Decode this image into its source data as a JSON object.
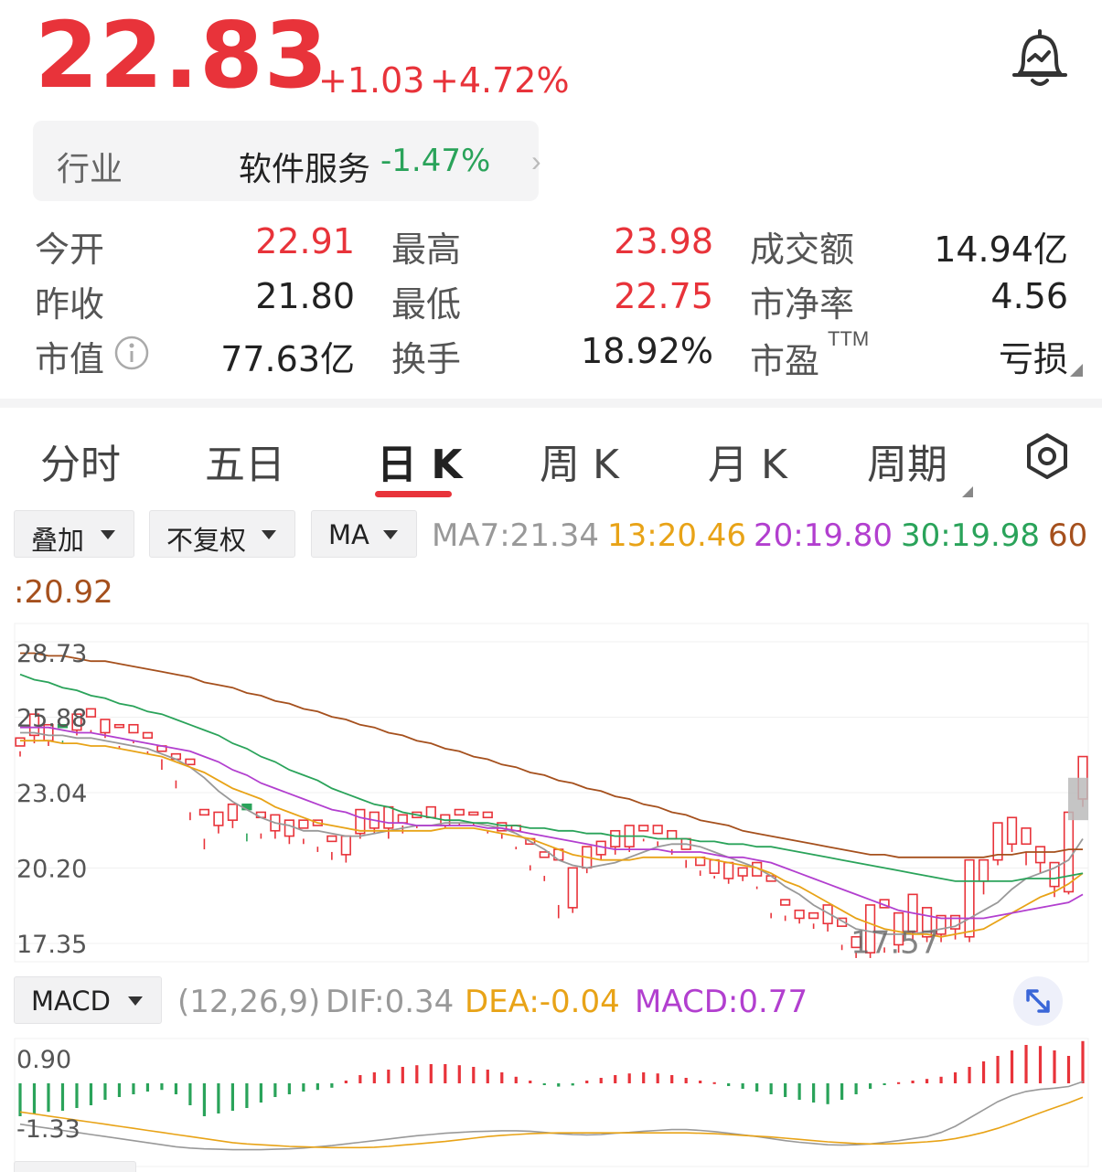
{
  "quote": {
    "price": "22.83",
    "change": "+1.03",
    "change_pct": "+4.72%"
  },
  "industry": {
    "label": "行业",
    "name": "软件服务",
    "change_pct": "-1.47%",
    "chevron": "›"
  },
  "stats": [
    {
      "label": "今开",
      "value": "22.91"
    },
    {
      "label": "最高",
      "value": "23.98"
    },
    {
      "label": "成交额",
      "value": "14.94亿"
    },
    {
      "label": "昨收",
      "value": "21.80"
    },
    {
      "label": "最低",
      "value": "22.75"
    },
    {
      "label": "市净率",
      "value": "4.56"
    },
    {
      "label": "市值",
      "value": "77.63亿"
    },
    {
      "label": "换手",
      "value": "18.92%"
    },
    {
      "label": "市盈",
      "sup": "TTM",
      "value": "亏损"
    }
  ],
  "tabs": [
    "分时",
    "五日",
    "日 K",
    "周 K",
    "月 K",
    "周期"
  ],
  "active_tab": "日 K",
  "controls": {
    "overlay": "叠加",
    "adjust": "不复权",
    "indicator": "MA"
  },
  "ma": {
    "ma7": "MA7:21.34",
    "ma13": "13:20.46",
    "ma20": "20:19.80",
    "ma30": "30:19.98",
    "ma60_prefix": "60",
    "ma60_value": ":20.92"
  },
  "colors": {
    "up": "#e8333a",
    "down": "#2aa35a",
    "ma7": "#999999",
    "ma13": "#e8a317",
    "ma20": "#b23fcf",
    "ma30": "#2aa35a",
    "ma60": "#a5501d"
  },
  "kline_axis": [
    "28.73",
    "25.88",
    "23.04",
    "20.20",
    "17.35"
  ],
  "kline_low_label": "17.57",
  "macd": {
    "indicator": "MACD",
    "params": "(12,26,9)",
    "dif": "DIF:0.34",
    "dea": "DEA:-0.04",
    "macd": "MACD:0.77",
    "axis_top": "0.90",
    "axis_bottom": "-1.33"
  },
  "chart_data": {
    "type": "candlestick",
    "yrange": [
      17.35,
      28.73
    ],
    "candles": [
      [
        24.8,
        25.1,
        24.4,
        24.6
      ],
      [
        25.2,
        26.0,
        24.9,
        25.5
      ],
      [
        25.0,
        25.6,
        24.8,
        25.5
      ],
      [
        25.6,
        25.5,
        24.9,
        25.0
      ],
      [
        25.4,
        26.0,
        25.2,
        25.8
      ],
      [
        25.9,
        26.2,
        25.3,
        25.4
      ],
      [
        25.3,
        25.8,
        25.1,
        25.7
      ],
      [
        25.5,
        25.6,
        24.7,
        24.8
      ],
      [
        25.3,
        25.6,
        24.9,
        25.0
      ],
      [
        25.1,
        25.3,
        24.5,
        24.6
      ],
      [
        24.6,
        24.8,
        23.9,
        24.3
      ],
      [
        24.3,
        24.5,
        23.2,
        23.5
      ],
      [
        24.1,
        24.3,
        22.0,
        22.3
      ],
      [
        22.2,
        22.4,
        20.9,
        21.3
      ],
      [
        21.8,
        22.3,
        21.5,
        22.2
      ],
      [
        22.0,
        22.6,
        21.7,
        22.3
      ],
      [
        22.6,
        22.4,
        21.2,
        21.5
      ],
      [
        22.1,
        22.3,
        21.3,
        21.5
      ],
      [
        21.6,
        22.2,
        21.3,
        22.1
      ],
      [
        21.4,
        22.0,
        21.1,
        21.9
      ],
      [
        21.7,
        22.0,
        21.1,
        21.3
      ],
      [
        21.8,
        22.0,
        20.8,
        21.0
      ],
      [
        21.2,
        21.4,
        20.5,
        20.8
      ],
      [
        20.7,
        21.4,
        20.4,
        21.1
      ],
      [
        21.5,
        22.4,
        21.3,
        22.2
      ],
      [
        21.7,
        22.3,
        21.5,
        22.0
      ],
      [
        21.7,
        22.5,
        21.3,
        22.0
      ],
      [
        21.9,
        22.2,
        21.5,
        21.8
      ],
      [
        22.1,
        22.3,
        21.7,
        21.8
      ],
      [
        22.1,
        22.5,
        21.8,
        21.8
      ],
      [
        21.8,
        22.2,
        21.7,
        22.1
      ],
      [
        22.2,
        22.4,
        21.8,
        21.9
      ],
      [
        22.2,
        22.3,
        21.8,
        21.9
      ],
      [
        22.1,
        22.3,
        21.5,
        21.6
      ],
      [
        21.6,
        21.9,
        21.3,
        21.5
      ],
      [
        21.6,
        21.8,
        20.9,
        21.0
      ],
      [
        21.1,
        21.3,
        20.1,
        20.3
      ],
      [
        20.6,
        20.8,
        19.7,
        19.9
      ],
      [
        20.5,
        20.9,
        18.3,
        18.8
      ],
      [
        18.7,
        20.2,
        18.5,
        19.8
      ],
      [
        20.2,
        21.0,
        20.0,
        20.8
      ],
      [
        20.7,
        21.2,
        20.5,
        21.1
      ],
      [
        21.0,
        21.6,
        20.7,
        21.2
      ],
      [
        21.0,
        21.8,
        20.8,
        21.6
      ],
      [
        21.6,
        21.8,
        21.2,
        21.3
      ],
      [
        21.5,
        21.8,
        21.0,
        21.2
      ],
      [
        21.3,
        21.6,
        20.7,
        20.9
      ],
      [
        20.9,
        21.3,
        20.2,
        20.5
      ],
      [
        20.3,
        20.6,
        19.9,
        20.1
      ],
      [
        20.0,
        20.5,
        19.8,
        19.9
      ],
      [
        19.8,
        20.4,
        19.6,
        20.1
      ],
      [
        19.9,
        20.2,
        19.7,
        20.1
      ],
      [
        19.9,
        20.4,
        19.4,
        19.5
      ],
      [
        19.7,
        19.9,
        18.3,
        18.5
      ],
      [
        18.8,
        19.0,
        18.2,
        18.4
      ],
      [
        18.3,
        18.6,
        18.1,
        18.5
      ],
      [
        18.3,
        18.5,
        17.9,
        18.1
      ],
      [
        18.1,
        18.8,
        17.8,
        18.2
      ],
      [
        18.0,
        18.3,
        17.1,
        17.3
      ],
      [
        17.2,
        17.6,
        16.8,
        17.0
      ],
      [
        17.0,
        18.8,
        16.8,
        17.9
      ],
      [
        18.7,
        19.0,
        17.0,
        17.2
      ],
      [
        17.3,
        18.5,
        17.0,
        18.1
      ],
      [
        17.8,
        19.2,
        17.5,
        18.1
      ],
      [
        17.6,
        18.7,
        17.4,
        17.7
      ],
      [
        17.7,
        18.4,
        17.4,
        18.1
      ],
      [
        17.9,
        18.4,
        17.5,
        18.1
      ],
      [
        17.6,
        20.5,
        17.4,
        20.4
      ],
      [
        19.7,
        20.5,
        19.2,
        19.9
      ],
      [
        20.5,
        21.9,
        20.3,
        21.7
      ],
      [
        21.1,
        22.1,
        20.8,
        21.9
      ],
      [
        21.1,
        21.7,
        20.3,
        20.8
      ],
      [
        20.4,
        21.0,
        20.0,
        20.7
      ],
      [
        19.5,
        20.4,
        19.1,
        19.7
      ],
      [
        19.3,
        22.3,
        19.2,
        22.2
      ],
      [
        22.8,
        24.4,
        22.5,
        22.8
      ]
    ],
    "ma_series": [
      {
        "name": "MA7",
        "values": [
          25.3,
          25.3,
          25.2,
          25.2,
          25.1,
          25.1,
          25.0,
          24.9,
          24.8,
          24.7,
          24.5,
          24.3,
          24.0,
          23.6,
          23.1,
          22.7,
          22.4,
          22.1,
          21.9,
          21.8,
          21.6,
          21.6,
          21.5,
          21.4,
          21.4,
          21.5,
          21.6,
          21.7,
          21.8,
          21.8,
          21.9,
          21.9,
          21.9,
          21.8,
          21.7,
          21.5,
          21.2,
          20.9,
          20.5,
          20.3,
          20.2,
          20.3,
          20.4,
          20.6,
          20.8,
          21.0,
          21.1,
          21.1,
          21.0,
          20.8,
          20.6,
          20.4,
          20.2,
          19.9,
          19.5,
          19.2,
          18.8,
          18.5,
          18.2,
          17.9,
          17.8,
          17.7,
          17.7,
          17.7,
          17.8,
          17.9,
          18.0,
          18.3,
          18.6,
          18.9,
          19.4,
          19.8,
          20.0,
          20.2,
          20.5,
          21.3
        ]
      },
      {
        "name": "13",
        "values": [
          25.0,
          25.0,
          25.0,
          24.9,
          24.9,
          24.8,
          24.8,
          24.7,
          24.6,
          24.5,
          24.4,
          24.2,
          24.0,
          23.8,
          23.5,
          23.2,
          23.0,
          22.8,
          22.5,
          22.3,
          22.1,
          21.9,
          21.8,
          21.7,
          21.6,
          21.6,
          21.6,
          21.6,
          21.6,
          21.6,
          21.7,
          21.7,
          21.7,
          21.6,
          21.5,
          21.4,
          21.3,
          21.1,
          20.9,
          20.7,
          20.6,
          20.5,
          20.5,
          20.5,
          20.6,
          20.6,
          20.6,
          20.6,
          20.6,
          20.5,
          20.4,
          20.3,
          20.2,
          20.0,
          19.7,
          19.5,
          19.2,
          18.9,
          18.6,
          18.3,
          18.1,
          17.9,
          17.8,
          17.7,
          17.7,
          17.6,
          17.7,
          17.8,
          17.9,
          18.2,
          18.5,
          18.8,
          19.1,
          19.3,
          19.6,
          20.0
        ]
      },
      {
        "name": "20",
        "values": [
          25.5,
          25.5,
          25.5,
          25.4,
          25.3,
          25.3,
          25.2,
          25.1,
          25.0,
          24.9,
          24.8,
          24.7,
          24.6,
          24.4,
          24.2,
          23.9,
          23.7,
          23.4,
          23.2,
          23.0,
          22.8,
          22.6,
          22.4,
          22.3,
          22.1,
          22.0,
          21.9,
          21.9,
          21.8,
          21.8,
          21.8,
          21.8,
          21.8,
          21.7,
          21.7,
          21.6,
          21.5,
          21.4,
          21.3,
          21.2,
          21.1,
          21.0,
          20.9,
          20.9,
          20.9,
          20.9,
          20.8,
          20.8,
          20.8,
          20.7,
          20.6,
          20.6,
          20.5,
          20.4,
          20.2,
          20.0,
          19.8,
          19.6,
          19.4,
          19.2,
          19.0,
          18.8,
          18.6,
          18.5,
          18.4,
          18.3,
          18.3,
          18.3,
          18.3,
          18.4,
          18.5,
          18.6,
          18.7,
          18.8,
          18.9,
          19.2
        ]
      },
      {
        "name": "30",
        "values": [
          27.5,
          27.3,
          27.2,
          27.0,
          26.9,
          26.7,
          26.6,
          26.4,
          26.3,
          26.1,
          26.0,
          25.8,
          25.6,
          25.4,
          25.2,
          24.9,
          24.7,
          24.4,
          24.2,
          23.9,
          23.7,
          23.5,
          23.2,
          23.0,
          22.8,
          22.6,
          22.5,
          22.3,
          22.2,
          22.1,
          22.0,
          22.0,
          21.9,
          21.9,
          21.8,
          21.8,
          21.7,
          21.7,
          21.6,
          21.6,
          21.5,
          21.5,
          21.4,
          21.4,
          21.4,
          21.3,
          21.3,
          21.3,
          21.2,
          21.2,
          21.1,
          21.1,
          21.0,
          21.0,
          20.9,
          20.8,
          20.7,
          20.6,
          20.5,
          20.4,
          20.3,
          20.2,
          20.1,
          20.0,
          19.9,
          19.8,
          19.7,
          19.7,
          19.7,
          19.7,
          19.7,
          19.8,
          19.8,
          19.8,
          19.9,
          20.0
        ]
      },
      {
        "name": "60",
        "values": [
          28.3,
          28.3,
          28.2,
          28.2,
          28.1,
          28.0,
          28.0,
          27.9,
          27.8,
          27.7,
          27.6,
          27.5,
          27.4,
          27.2,
          27.1,
          27.0,
          26.8,
          26.7,
          26.5,
          26.4,
          26.2,
          26.1,
          25.9,
          25.8,
          25.6,
          25.5,
          25.3,
          25.2,
          25.0,
          24.9,
          24.7,
          24.6,
          24.4,
          24.3,
          24.1,
          24.0,
          23.8,
          23.7,
          23.5,
          23.4,
          23.2,
          23.1,
          22.9,
          22.8,
          22.6,
          22.5,
          22.3,
          22.2,
          22.0,
          21.9,
          21.8,
          21.6,
          21.5,
          21.4,
          21.3,
          21.2,
          21.1,
          21.0,
          20.9,
          20.8,
          20.7,
          20.7,
          20.6,
          20.6,
          20.6,
          20.6,
          20.6,
          20.6,
          20.6,
          20.7,
          20.7,
          20.8,
          20.8,
          20.8,
          20.9,
          20.9
        ]
      }
    ],
    "macd_range": [
      -1.33,
      0.9
    ],
    "macd_hist": [
      -0.6,
      -0.55,
      -0.52,
      -0.5,
      -0.45,
      -0.4,
      -0.3,
      -0.25,
      -0.2,
      -0.15,
      -0.12,
      -0.2,
      -0.4,
      -0.6,
      -0.55,
      -0.5,
      -0.45,
      -0.35,
      -0.25,
      -0.2,
      -0.15,
      -0.12,
      -0.08,
      0.05,
      0.15,
      0.2,
      0.25,
      0.3,
      0.33,
      0.35,
      0.35,
      0.33,
      0.3,
      0.25,
      0.2,
      0.12,
      0.05,
      -0.02,
      -0.06,
      -0.04,
      0.05,
      0.1,
      0.15,
      0.18,
      0.2,
      0.18,
      0.15,
      0.1,
      0.05,
      0.02,
      -0.05,
      -0.1,
      -0.15,
      -0.2,
      -0.25,
      -0.3,
      -0.35,
      -0.38,
      -0.3,
      -0.2,
      -0.1,
      -0.03,
      0.02,
      0.05,
      0.08,
      0.12,
      0.2,
      0.3,
      0.4,
      0.5,
      0.6,
      0.7,
      0.68,
      0.6,
      0.5,
      0.77
    ],
    "dif": [
      -0.7,
      -0.75,
      -0.8,
      -0.85,
      -0.9,
      -0.95,
      -1.0,
      -1.05,
      -1.1,
      -1.15,
      -1.2,
      -1.25,
      -1.28,
      -1.3,
      -1.31,
      -1.32,
      -1.32,
      -1.32,
      -1.31,
      -1.3,
      -1.28,
      -1.25,
      -1.22,
      -1.18,
      -1.14,
      -1.1,
      -1.06,
      -1.02,
      -0.98,
      -0.95,
      -0.92,
      -0.9,
      -0.88,
      -0.87,
      -0.86,
      -0.86,
      -0.87,
      -0.9,
      -0.93,
      -0.95,
      -0.96,
      -0.95,
      -0.92,
      -0.9,
      -0.87,
      -0.85,
      -0.83,
      -0.83,
      -0.85,
      -0.88,
      -0.92,
      -0.96,
      -1.0,
      -1.05,
      -1.1,
      -1.14,
      -1.17,
      -1.2,
      -1.21,
      -1.2,
      -1.18,
      -1.14,
      -1.1,
      -1.05,
      -1.0,
      -0.9,
      -0.75,
      -0.55,
      -0.35,
      -0.15,
      0.0,
      0.1,
      0.15,
      0.18,
      0.22,
      0.34
    ],
    "dea": [
      -0.4,
      -0.45,
      -0.5,
      -0.55,
      -0.6,
      -0.65,
      -0.7,
      -0.75,
      -0.8,
      -0.85,
      -0.9,
      -0.95,
      -1.0,
      -1.05,
      -1.1,
      -1.15,
      -1.18,
      -1.2,
      -1.22,
      -1.24,
      -1.25,
      -1.26,
      -1.27,
      -1.27,
      -1.27,
      -1.26,
      -1.24,
      -1.21,
      -1.18,
      -1.15,
      -1.12,
      -1.08,
      -1.04,
      -1.0,
      -0.97,
      -0.95,
      -0.93,
      -0.92,
      -0.91,
      -0.91,
      -0.91,
      -0.91,
      -0.91,
      -0.91,
      -0.91,
      -0.91,
      -0.91,
      -0.91,
      -0.92,
      -0.93,
      -0.95,
      -0.97,
      -0.99,
      -1.01,
      -1.04,
      -1.07,
      -1.1,
      -1.13,
      -1.15,
      -1.17,
      -1.18,
      -1.18,
      -1.17,
      -1.15,
      -1.13,
      -1.1,
      -1.05,
      -0.98,
      -0.9,
      -0.8,
      -0.68,
      -0.55,
      -0.42,
      -0.3,
      -0.18,
      -0.04
    ]
  }
}
